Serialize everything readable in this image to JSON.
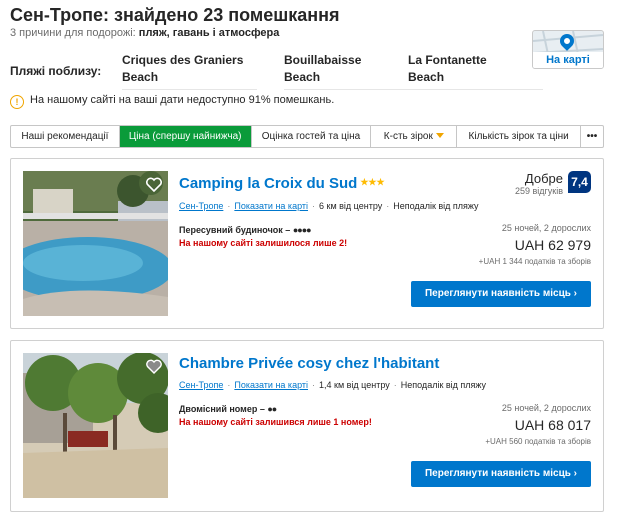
{
  "header": {
    "title": "Сен-Тропе: знайдено 23 помешкання",
    "subtitle_prefix": "3 причини для подорожі:",
    "subtitle_reasons": "пляж, гавань і атмосфера"
  },
  "map": {
    "label": "На карті"
  },
  "beaches": {
    "label": "Пляжі поблизу:",
    "items": [
      {
        "line1": "Criques des Graniers",
        "line2": "Beach"
      },
      {
        "line1": "Bouillabaisse",
        "line2": "Beach"
      },
      {
        "line1": "La Fontanette",
        "line2": "Beach"
      }
    ]
  },
  "notice": {
    "icon": "info-icon",
    "text": "На нашому сайті на ваші дати недоступно 91% помешкань."
  },
  "sort_tabs": [
    {
      "label": "Наші рекомендації",
      "active": false
    },
    {
      "label": "Ціна (спершу найнижча)",
      "active": true
    },
    {
      "label": "Оцінка гостей та ціна",
      "active": false
    },
    {
      "label": "К-сть зірок",
      "active": false
    },
    {
      "label": "Кількість зірок та ціни",
      "active": false
    },
    {
      "label": "•••",
      "active": false
    }
  ],
  "hotels": [
    {
      "name": "Camping la Croix du Sud",
      "stars": 3,
      "city": "Сен-Тропе",
      "map_link": "Показати на карті",
      "distance": "6 км від центру",
      "beach": "Неподалік від пляжу",
      "room": "Пересувний будиночок –",
      "warning": "На нашому сайті залишилося лише 2!",
      "review_word": "Добре",
      "review_count": "259 відгуків",
      "score": "7,4",
      "nights": "25 ночей, 2 дорослих",
      "price": "UAH 62 979",
      "taxes": "+UAH 1 344 податків та зборів",
      "cta": "Переглянути наявність місць"
    },
    {
      "name": "Chambre Privée cosy chez l'habitant",
      "stars": 0,
      "city": "Сен-Тропе",
      "map_link": "Показати на карті",
      "distance": "1,4 км від центру",
      "beach": "Неподалік від пляжу",
      "room": "Двомісний номер –",
      "warning": "На нашому сайті залишився лише 1 номер!",
      "nights": "25 ночей, 2 дорослих",
      "price": "UAH 68 017",
      "taxes": "+UAH 560 податків та зборів",
      "cta": "Переглянути наявність місць"
    }
  ]
}
